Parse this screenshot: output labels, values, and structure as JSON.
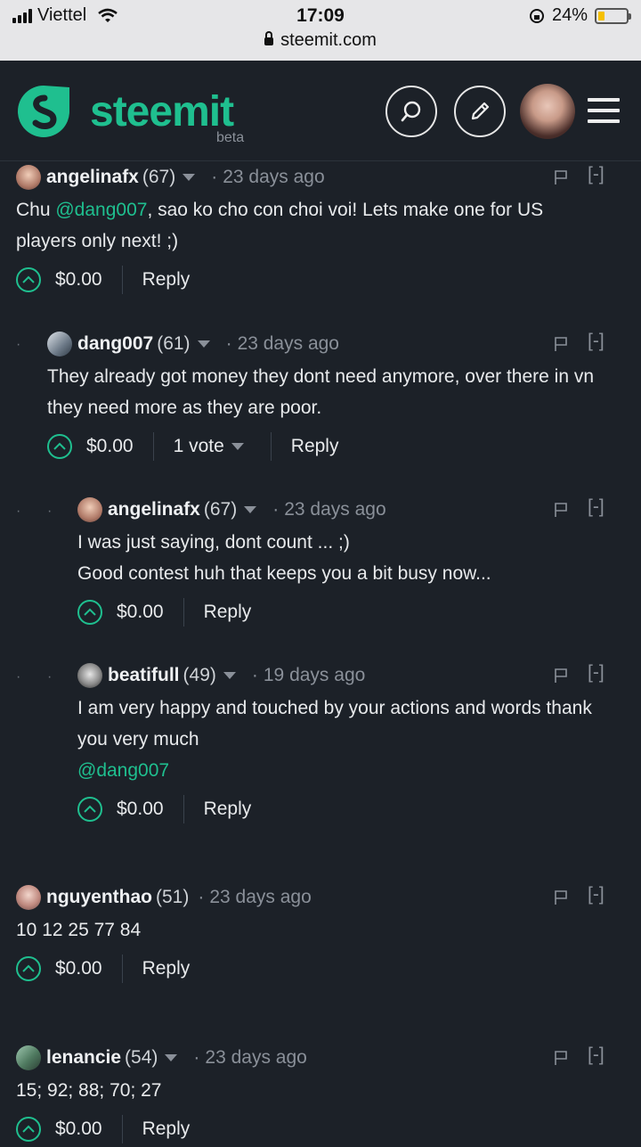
{
  "status": {
    "carrier": "Viettel",
    "time": "17:09",
    "battery": "24%",
    "battery_level": 0.24,
    "url": "steemit.com"
  },
  "header": {
    "brand": "steemit",
    "beta": "beta"
  },
  "colors": {
    "accent": "#1fbf8f",
    "bg": "#1c2128",
    "muted": "#8a9099"
  },
  "comments": [
    {
      "author": "angelinafx",
      "rep": "(67)",
      "time": "23 days ago",
      "body_pre": "Chu ",
      "mention": "@dang007",
      "body_post": ", sao ko cho con choi voi! Lets make one for US players only next! ;)",
      "payout": "$0.00",
      "reply": "Reply",
      "collapse": "[-]"
    },
    {
      "author": "dang007",
      "rep": "(61)",
      "time": "23 days ago",
      "body": "They already got money they dont need anymore, over there in vn they need more as they are poor.",
      "payout": "$0.00",
      "votes": "1 vote",
      "reply": "Reply",
      "collapse": "[-]"
    },
    {
      "author": "angelinafx",
      "rep": "(67)",
      "time": "23 days ago",
      "body_line1": "I was just saying, dont count ... ;)",
      "body_line2": "Good contest huh that keeps you a bit busy now...",
      "payout": "$0.00",
      "reply": "Reply",
      "collapse": "[-]"
    },
    {
      "author": "beatifull",
      "rep": "(49)",
      "time": "19 days ago",
      "body": "I am very happy and touched by your actions and words thank you very much",
      "mention": "@dang007",
      "payout": "$0.00",
      "reply": "Reply",
      "collapse": "[-]"
    },
    {
      "author": "nguyenthao",
      "rep": "(51)",
      "time": "23 days ago",
      "body": "10 12 25 77 84",
      "payout": "$0.00",
      "reply": "Reply",
      "collapse": "[-]"
    },
    {
      "author": "lenancie",
      "rep": "(54)",
      "time": "23 days ago",
      "body": "15; 92; 88; 70; 27",
      "payout": "$0.00",
      "reply": "Reply",
      "collapse": "[-]"
    }
  ],
  "icons": [
    "signal-icon",
    "wifi-icon",
    "lock-icon",
    "battery-icon",
    "steemit-logo-icon",
    "search-icon",
    "edit-icon",
    "menu-icon",
    "flag-icon",
    "upvote-icon",
    "caret-down-icon"
  ]
}
